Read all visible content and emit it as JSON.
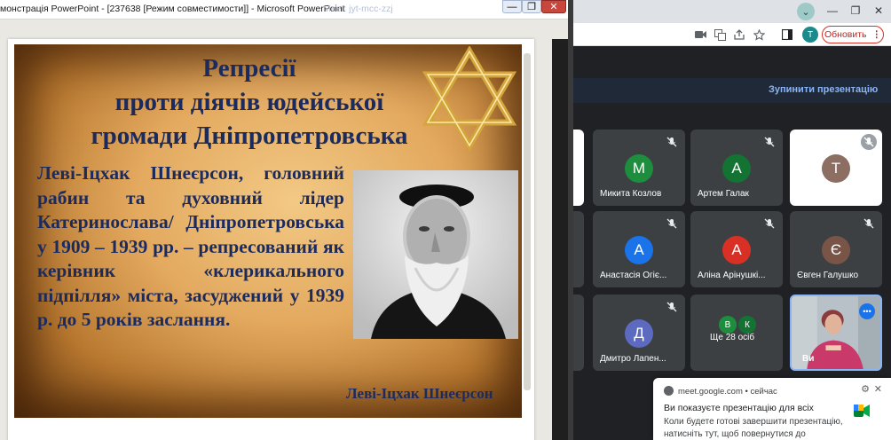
{
  "ppt": {
    "title": "монстрація PowerPoint - [237638 [Режим совместимости]] - Microsoft PowerPoint",
    "ghost_tab": "Meet: jyt-mcc-zzj"
  },
  "slide": {
    "title_lines": [
      "Репресії",
      "проти діячів юдейської",
      "громади Дніпропетровська"
    ],
    "body": "Леві-Іцхак Шнеєрсон, головний рабин та духовний лідер Катеринослава/ Дніпропетровська у 1909 – 1939 рр. – репресований як керівник «клерикального підпілля» міста, засуджений у 1939 р. до 5 років заслання.",
    "caption": "Леві-Іцхак Шнеєрсон",
    "star_color": "#d4a53c"
  },
  "chrome": {
    "update_label": "Обновить",
    "profile_letter": "T",
    "tab_menu_letter": "⌄"
  },
  "meet": {
    "stop_presenting": "Зупинити презентацію",
    "participants": [
      {
        "name": "Микита Козлов",
        "initial": "М",
        "color": "#1e8e3e"
      },
      {
        "name": "Артем Галак",
        "initial": "А",
        "color": "#137333"
      },
      {
        "name": "",
        "initial": "Т",
        "color": "#8d6e63"
      },
      {
        "name": "Анастасія Огіє...",
        "initial": "А",
        "color": "#1a73e8"
      },
      {
        "name": "Аліна Арінушкі...",
        "initial": "А",
        "color": "#d93025"
      },
      {
        "name": "Євген Галушко",
        "initial": "Є",
        "color": "#795548"
      },
      {
        "name": "Дмитро Лапен...",
        "initial": "Д",
        "color": "#5c6bc0"
      }
    ],
    "more": {
      "label": "Ще 28 осіб",
      "initials": [
        "В",
        "К"
      ],
      "colors": [
        "#1e8e3e",
        "#137333"
      ]
    },
    "self_label": "Ви"
  },
  "notification": {
    "source": "meet.google.com • сейчас",
    "title": "Ви показуєте презентацію для всіх",
    "body": "Коли будете готові завершити презентацію, натисніть тут, щоб повернутися до"
  },
  "colors": {
    "slide_text": "#1c2b5e",
    "meet_link": "#8ab4f8",
    "update_border": "#d93025"
  }
}
